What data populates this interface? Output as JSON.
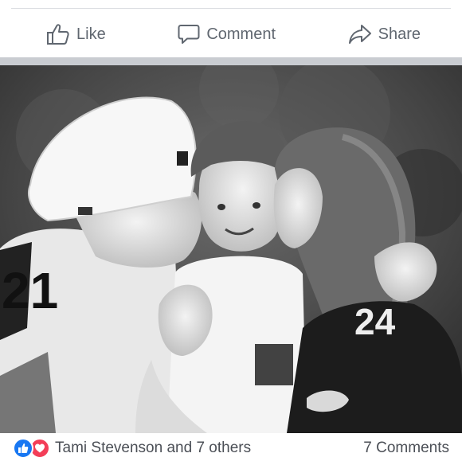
{
  "actions": {
    "like_label": "Like",
    "comment_label": "Comment",
    "share_label": "Share"
  },
  "post": {
    "photo_icon": "family-photo-image"
  },
  "reactions": {
    "icons": [
      "like-icon",
      "love-icon"
    ],
    "names": "Tami Stevenson and 7 others",
    "comments": "7 Comments"
  },
  "colors": {
    "action_text": "#606770",
    "like_blue": "#1877f2",
    "love_red": "#f33e58",
    "separator": "#c9ccd1"
  }
}
